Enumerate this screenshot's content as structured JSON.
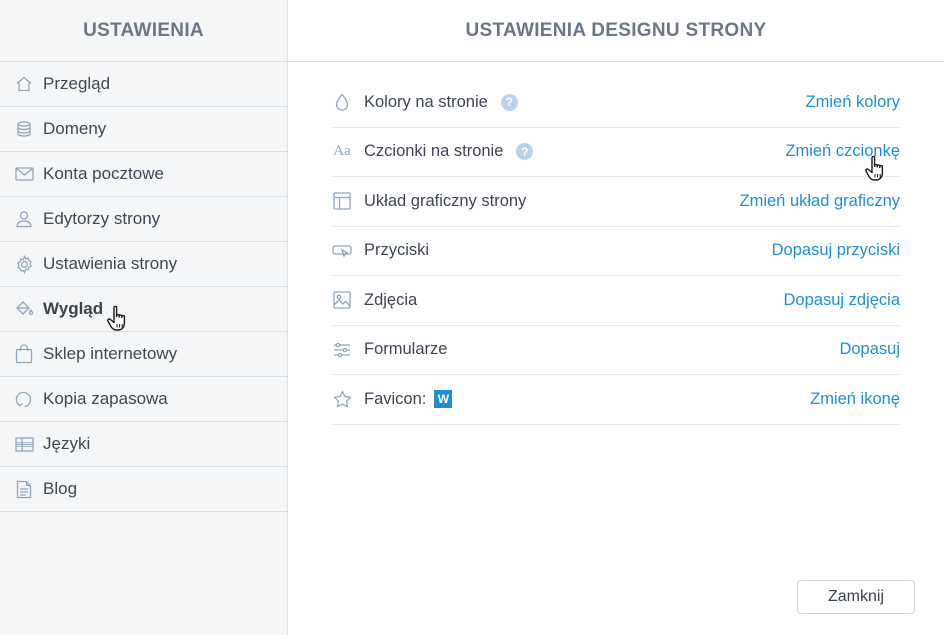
{
  "sidebar": {
    "title": "USTAWIENIA",
    "items": [
      {
        "label": "Przegląd",
        "icon": "home-icon"
      },
      {
        "label": "Domeny",
        "icon": "database-icon"
      },
      {
        "label": "Konta pocztowe",
        "icon": "envelope-icon"
      },
      {
        "label": "Edytorzy strony",
        "icon": "user-icon"
      },
      {
        "label": "Ustawienia strony",
        "icon": "gear-icon"
      },
      {
        "label": "Wygląd",
        "icon": "paint-bucket-icon",
        "active": true
      },
      {
        "label": "Sklep internetowy",
        "icon": "shopping-bag-icon"
      },
      {
        "label": "Kopia zapasowa",
        "icon": "backup-icon"
      },
      {
        "label": "Języki",
        "icon": "flag-icon"
      },
      {
        "label": "Blog",
        "icon": "document-icon"
      }
    ]
  },
  "main": {
    "title": "USTAWIENIA DESIGNU STRONY",
    "rows": [
      {
        "label": "Kolory na stronie",
        "link": "Zmień kolory",
        "icon": "droplet-icon",
        "help": "?"
      },
      {
        "label": "Czcionki na stronie",
        "link": "Zmień czcionkę",
        "icon": "font-icon",
        "icon_text": "Aa",
        "help": "?"
      },
      {
        "label": "Układ graficzny strony",
        "link": "Zmień układ graficzny",
        "icon": "layout-icon"
      },
      {
        "label": "Przyciski",
        "link": "Dopasuj przyciski",
        "icon": "button-icon"
      },
      {
        "label": "Zdjęcia",
        "link": "Dopasuj zdjęcia",
        "icon": "image-icon"
      },
      {
        "label": "Formularze",
        "link": "Dopasuj",
        "icon": "sliders-icon"
      },
      {
        "label": "Favicon:",
        "link": "Zmień ikonę",
        "icon": "star-icon",
        "badge": "W"
      }
    ],
    "close_label": "Zamknij"
  },
  "colors": {
    "accent": "#1e8fd6",
    "icon": "#8fa6bf",
    "sidebar_bg": "#f5f6f7",
    "header_text": "#6c7689"
  }
}
